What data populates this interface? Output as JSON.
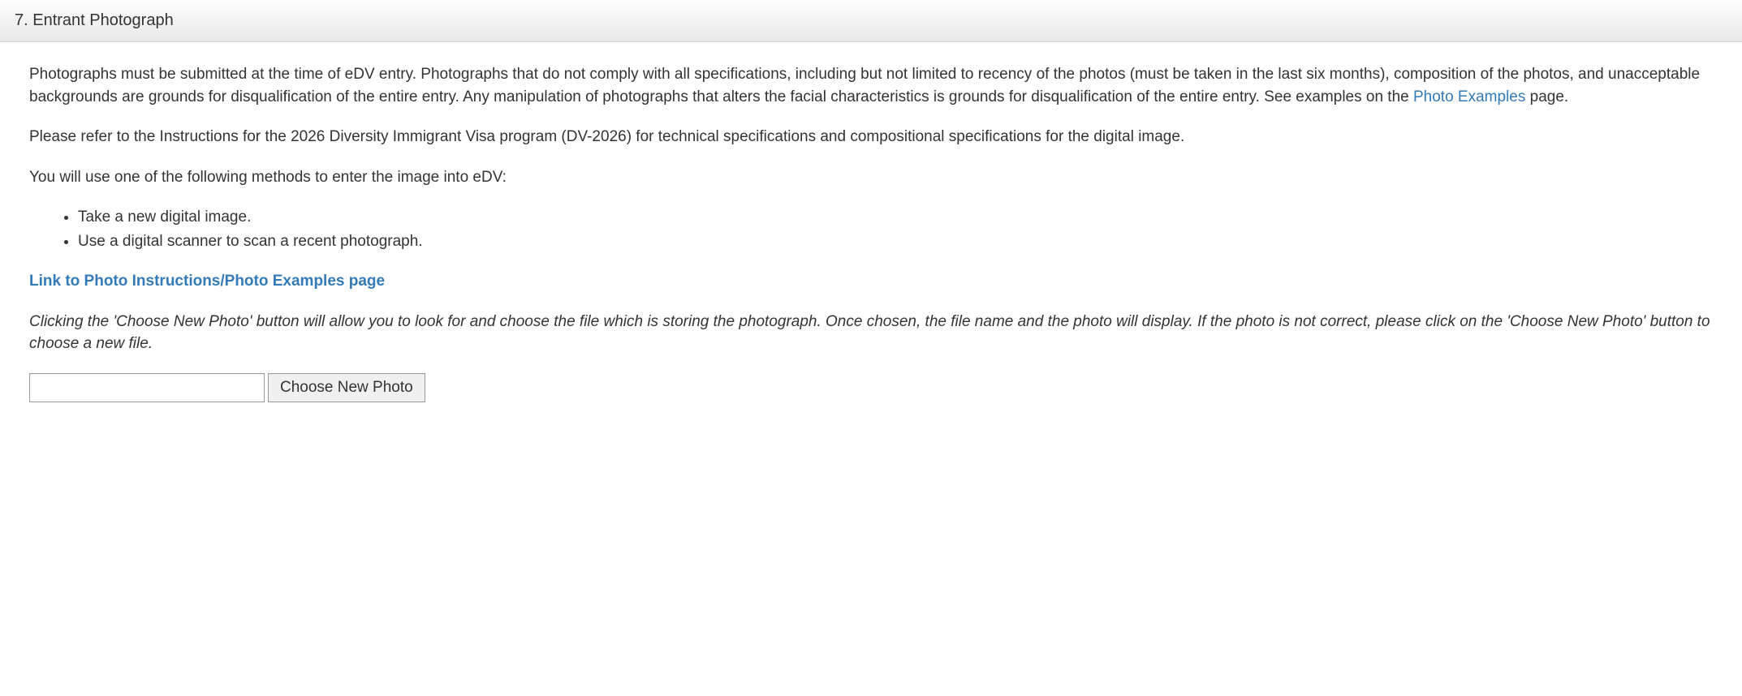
{
  "header": {
    "title": "7. Entrant Photograph"
  },
  "para1_a": "Photographs must be submitted at the time of eDV entry. Photographs that do not comply with all specifications, including but not limited to recency of the photos (must be taken in the last six months), composition of the photos, and unacceptable backgrounds are grounds for disqualification of the entire entry. Any manipulation of photographs that alters the facial characteristics is grounds for disqualification of the entire entry. See examples on the ",
  "para1_link": "Photo Examples",
  "para1_b": " page.",
  "para2": "Please refer to the Instructions for the 2026 Diversity Immigrant Visa program (DV-2026) for technical specifications and compositional specifications for the digital image.",
  "para3": "You will use one of the following methods to enter the image into eDV:",
  "methods": {
    "item0": "Take a new digital image.",
    "item1": "Use a digital scanner to scan a recent photograph."
  },
  "instructions_link": "Link to Photo Instructions/Photo Examples page",
  "italic_note": "Clicking the 'Choose New Photo' button will allow you to look for and choose the file which is storing the photograph. Once chosen, the file name and the photo will display. If the photo is not correct, please click on the 'Choose New Photo' button to choose a new file.",
  "upload": {
    "filename_value": "",
    "button_label": "Choose New Photo"
  }
}
